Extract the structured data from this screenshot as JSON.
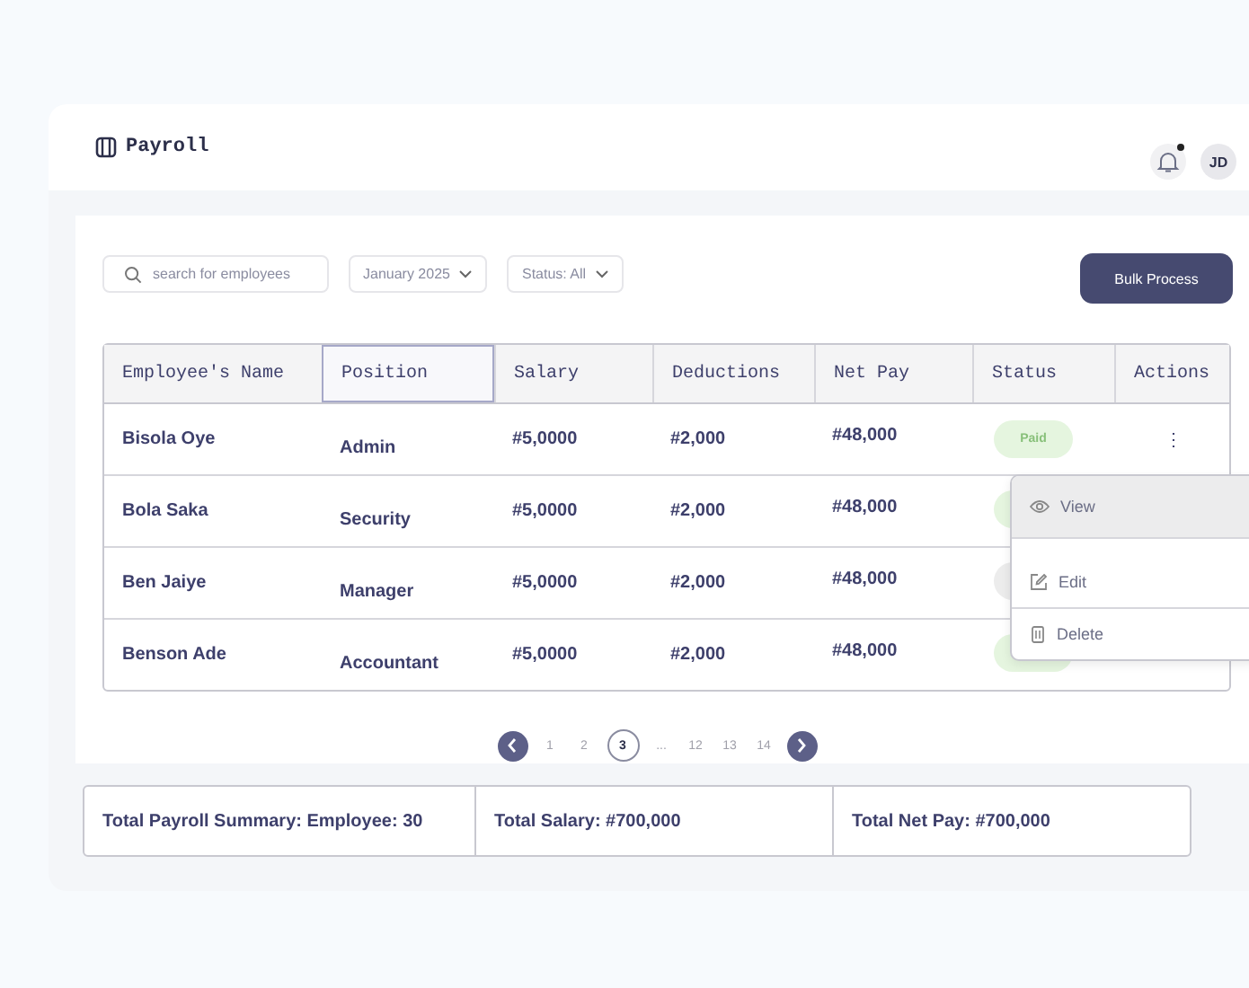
{
  "app": {
    "title": "Payroll",
    "user_initials": "JD",
    "has_notification": true
  },
  "toolbar": {
    "search": {
      "placeholder": "search for employees"
    },
    "month": "January 2025",
    "status_filter": "Status: All",
    "bulk_button": "Bulk Process"
  },
  "table": {
    "columns": [
      {
        "label": "Employee's Name",
        "selected": false
      },
      {
        "label": "Position",
        "selected": true
      },
      {
        "label": "Salary",
        "selected": false
      },
      {
        "label": "Deductions",
        "selected": false
      },
      {
        "label": "Net Pay",
        "selected": false
      },
      {
        "label": "Status",
        "selected": false
      },
      {
        "label": "Actions",
        "selected": false
      }
    ],
    "rows": [
      {
        "name": "Bisola Oye",
        "position": "Admin",
        "salary": "#5,0000",
        "deductions": "#2,000",
        "net_pay": "#48,000",
        "status": {
          "text": "Paid",
          "color": "#e5f5df"
        },
        "actions": "⋮"
      },
      {
        "name": "Bola Saka",
        "position": "Security",
        "salary": "#5,0000",
        "deductions": "#2,000",
        "net_pay": "#48,000",
        "status": {
          "color": "#e5f5df"
        }
      },
      {
        "name": "Ben Jaiye",
        "position": "Manager",
        "salary": "#5,0000",
        "deductions": "#2,000",
        "net_pay": "#48,000",
        "status": {
          "color": "#ececec"
        }
      },
      {
        "name": "Benson Ade",
        "position": "Accountant",
        "salary": "#5,0000",
        "deductions": "#2,000",
        "net_pay": "#48,000",
        "status": {
          "color": "#e5f5df"
        }
      }
    ]
  },
  "action_menu": {
    "items": [
      {
        "label": "View",
        "kind": "view",
        "selected": true
      },
      {
        "label": "Edit",
        "kind": "edit",
        "selected": false
      },
      {
        "label": "Delete",
        "kind": "delete",
        "selected": false
      }
    ]
  },
  "pagination": {
    "pages": [
      {
        "label": "1",
        "selected": false
      },
      {
        "label": "2",
        "selected": false
      },
      {
        "label": "3",
        "selected": true
      },
      {
        "label": "...",
        "selected": false
      },
      {
        "label": "12",
        "selected": false
      },
      {
        "label": "13",
        "selected": false
      },
      {
        "label": "14",
        "selected": false
      }
    ]
  },
  "summary": [
    "Total Payroll Summary: Employee: 30",
    "Total Salary: #700,000",
    "Total Net Pay: #700,000"
  ]
}
